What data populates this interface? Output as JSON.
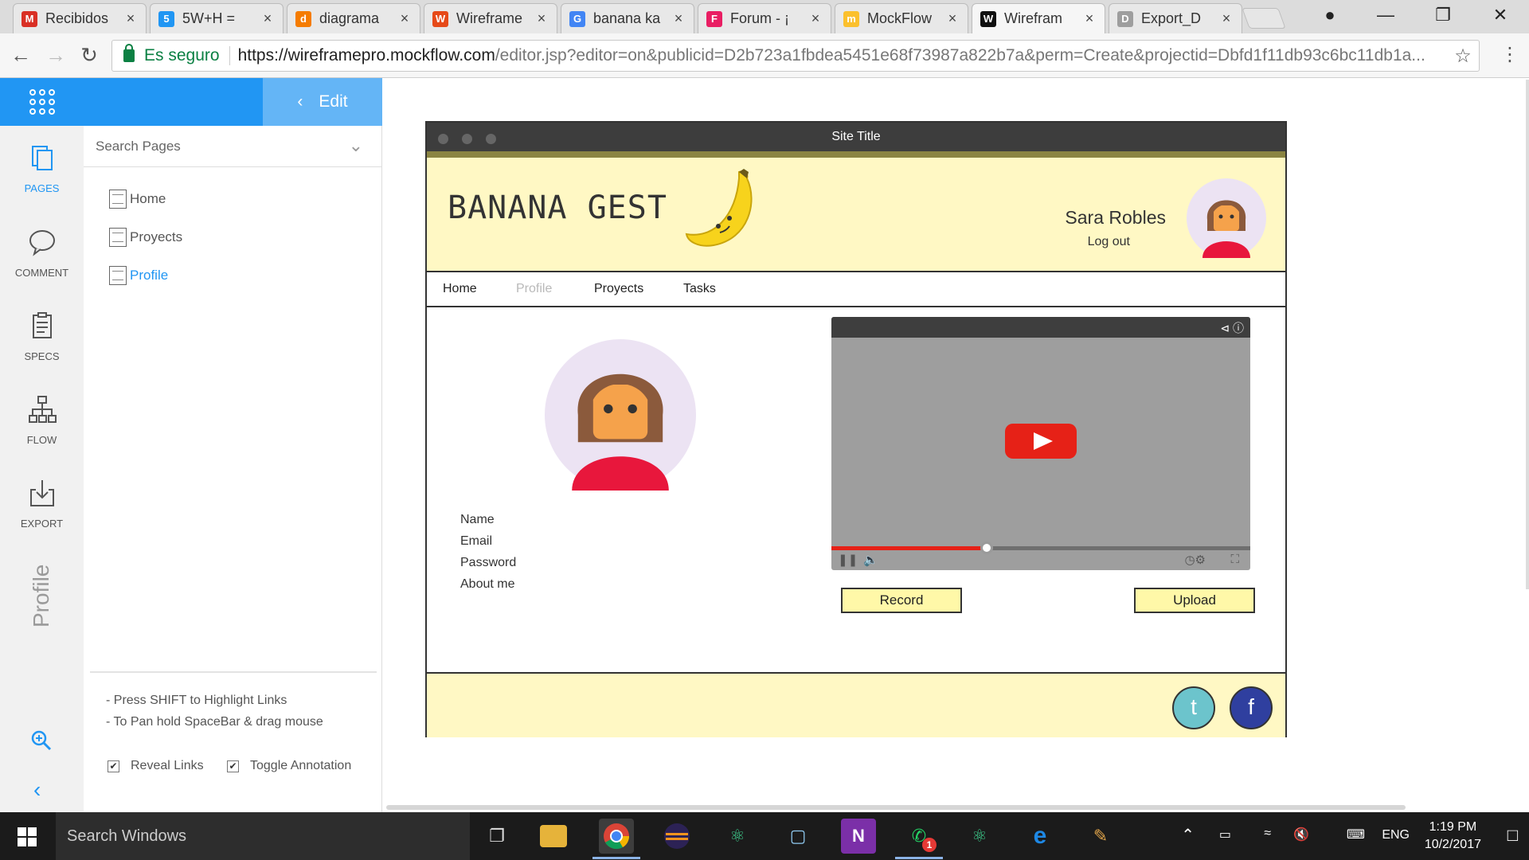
{
  "browser": {
    "tabs": [
      {
        "title": "Recibidos",
        "icon": "gmail-icon",
        "color": "#d93025",
        "glyph": "M"
      },
      {
        "title": "5W+H = ",
        "icon": "5wh-icon",
        "color": "#2196f3",
        "glyph": "5"
      },
      {
        "title": "diagrama",
        "icon": "diagram-icon",
        "color": "#f57c00",
        "glyph": "d"
      },
      {
        "title": "Wireframe",
        "icon": "wireframe-icon",
        "color": "#e64a19",
        "glyph": "W"
      },
      {
        "title": "banana ka",
        "icon": "google-icon",
        "color": "#4285f4",
        "glyph": "G"
      },
      {
        "title": "Forum - ¡",
        "icon": "forum-icon",
        "color": "#e91e63",
        "glyph": "F"
      },
      {
        "title": "MockFlow",
        "icon": "mockflow-icon",
        "color": "#fbc02d",
        "glyph": "m"
      },
      {
        "title": "Wirefram",
        "icon": "wireframepro-icon",
        "color": "#111111",
        "glyph": "W"
      },
      {
        "title": "Export_D",
        "icon": "document-icon",
        "color": "#9e9e9e",
        "glyph": "D"
      }
    ],
    "secure_label": "Es seguro",
    "url_host": "https://wireframepro.mockflow.com",
    "url_path": "/editor.jsp?editor=on&publicid=D2b723a1fbdea5451e68f73987a822b7a&perm=Create&projectid=Dbfd1f11db93c6bc11db1a..."
  },
  "editor": {
    "edit_label": "Edit",
    "rail": [
      {
        "label": "PAGES",
        "icon": "pages-icon"
      },
      {
        "label": "COMMENT",
        "icon": "comment-icon"
      },
      {
        "label": "SPECS",
        "icon": "specs-icon"
      },
      {
        "label": "FLOW",
        "icon": "flow-icon"
      },
      {
        "label": "EXPORT",
        "icon": "export-icon"
      }
    ],
    "current_page_vertical": "Profile",
    "search_placeholder": "Search Pages",
    "pages": [
      "Home",
      "Proyects",
      "Profile"
    ],
    "active_page": "Profile",
    "hints": [
      "- Press SHIFT to Highlight Links",
      "- To Pan hold SpaceBar & drag mouse"
    ],
    "reveal_links": "Reveal Links",
    "toggle_annotation": "Toggle Annotation"
  },
  "wireframe": {
    "site_title": "Site Title",
    "brand": "BANANA GEST",
    "user_name": "Sara Robles",
    "logout": "Log out",
    "nav": [
      "Home",
      "Profile",
      "Proyects",
      "Tasks"
    ],
    "current_nav": "Profile",
    "form_labels": [
      "Name",
      "Email",
      "Password",
      "About me"
    ],
    "video_progress": 0.37,
    "record_label": "Record",
    "upload_label": "Upload",
    "social": [
      {
        "glyph": "t",
        "color": "#6cc4cc",
        "icon": "twitter-icon"
      },
      {
        "glyph": "f",
        "color": "#2f3f9f",
        "icon": "facebook-icon"
      }
    ]
  },
  "taskbar": {
    "search": "Search Windows",
    "lang": "ENG",
    "time": "1:19 PM",
    "date": "10/2/2017",
    "whatsapp_badge": "1"
  }
}
